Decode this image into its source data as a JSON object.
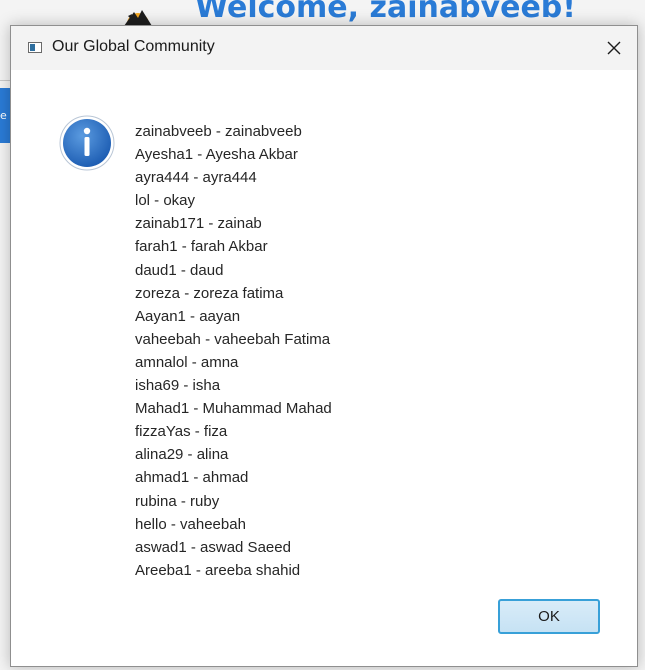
{
  "background": {
    "welcome_text": "Welcome, zainabveeb!",
    "side_tab_text": "e"
  },
  "dialog": {
    "title": "Our Global Community",
    "close_glyph": "✕",
    "icon": "info-icon",
    "members": [
      "zainabveeb - zainabveeb",
      "Ayesha1 - Ayesha Akbar",
      "ayra444 - ayra444",
      "lol - okay",
      "zainab171 - zainab",
      "farah1 - farah Akbar",
      "daud1 - daud",
      "zoreza - zoreza fatima",
      "Aayan1 - aayan",
      "vaheebah - vaheebah Fatima",
      "amnalol - amna",
      "isha69 - isha",
      "Mahad1 - Muhammad Mahad",
      "fizzaYas - fiza",
      "alina29 - alina",
      "ahmad1 - ahmad",
      "rubina - ruby",
      "hello - vaheebah",
      "aswad1 - aswad Saeed",
      "Areeba1 - areeba shahid"
    ],
    "ok_label": "OK"
  },
  "colors": {
    "accent": "#2a7bd6",
    "ok_border": "#38a0d8",
    "info_icon": "#2f6fc0"
  }
}
